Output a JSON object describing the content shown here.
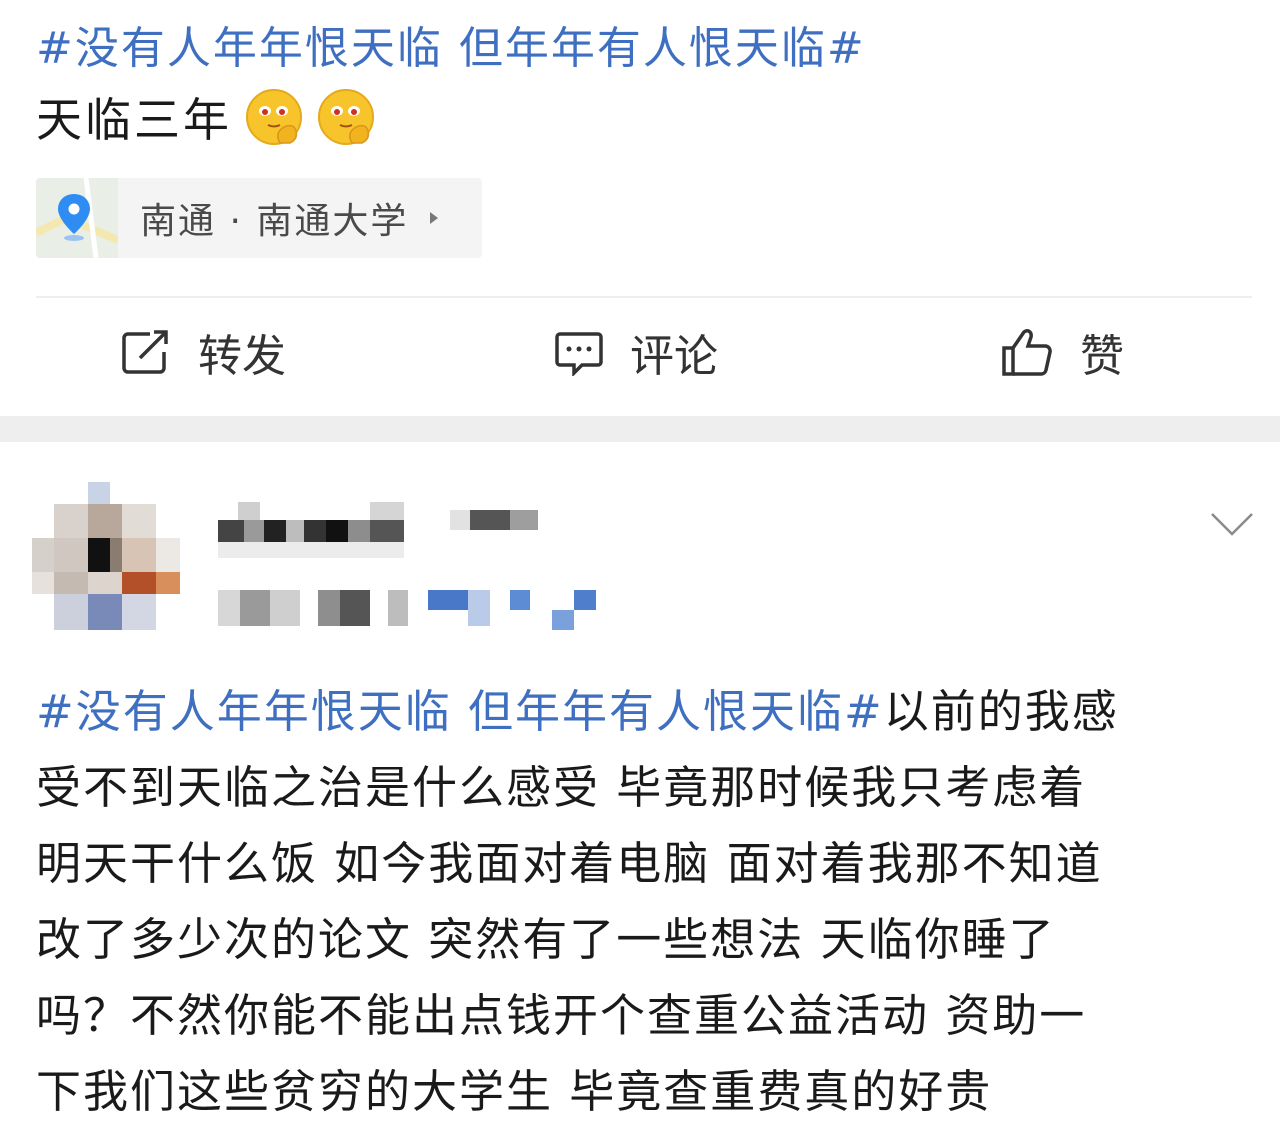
{
  "post1": {
    "topic": "#没有人年年恨天临 但年年有人恨天临#",
    "text": "天临三年",
    "emojis": [
      "thinking-face-emoji",
      "thinking-face-emoji"
    ],
    "location": {
      "label": "南通 · 南通大学",
      "icon": "map-pin-icon"
    },
    "actions": [
      {
        "label": "转发",
        "icon": "repost-icon"
      },
      {
        "label": "评论",
        "icon": "comment-icon"
      },
      {
        "label": "赞",
        "icon": "thumbs-up-icon"
      }
    ]
  },
  "post2": {
    "topic": "#没有人年年恨天临 但年年有人恨天临#",
    "lines": [
      "以前的我感",
      "受不到天临之治是什么感受 毕竟那时候我只考虑着",
      "明天干什么饭 如今我面对着电脑 面对着我那不知道",
      "改了多少次的论文 突然有了一些想法 天临你睡了",
      "吗？不然你能不能出点钱开个查重公益活动 资助一",
      "下我们这些贫穷的大学生 毕竟查重费真的好贵"
    ]
  },
  "colors": {
    "topic": "#3f6fc0",
    "text": "#1a1a1a",
    "separator": "#eeeeee"
  }
}
